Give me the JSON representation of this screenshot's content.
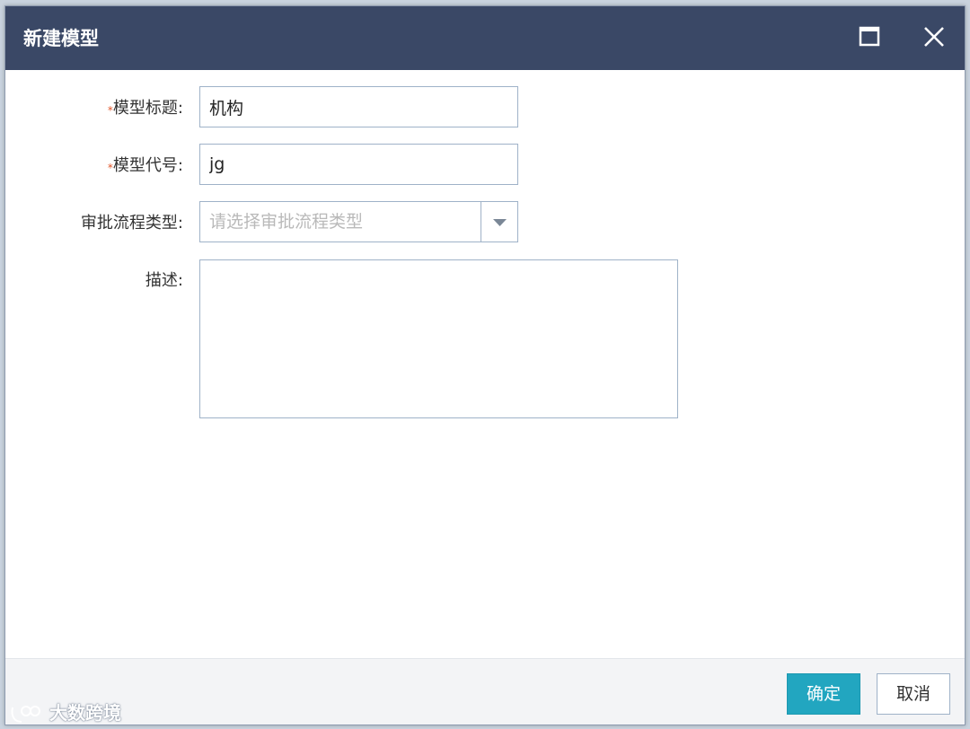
{
  "dialog": {
    "title": "新建模型",
    "maximize_icon": "maximize-icon",
    "close_icon": "close-icon"
  },
  "form": {
    "title_field": {
      "required_mark": "*",
      "label": "模型标题:",
      "value": "机构"
    },
    "code_field": {
      "required_mark": "*",
      "label": "模型代号:",
      "value": "jg"
    },
    "approval_field": {
      "label": "审批流程类型:",
      "placeholder": "请选择审批流程类型",
      "arrow_icon": "chevron-down-icon"
    },
    "description_field": {
      "label": "描述:",
      "value": ""
    }
  },
  "footer": {
    "confirm_label": "确定",
    "cancel_label": "取消"
  },
  "watermark": {
    "text": "大数跨境"
  },
  "colors": {
    "titlebar": "#3a4866",
    "confirm_button": "#22a6c0",
    "required_mark": "#e0562a",
    "field_border": "#9fb2c8"
  }
}
